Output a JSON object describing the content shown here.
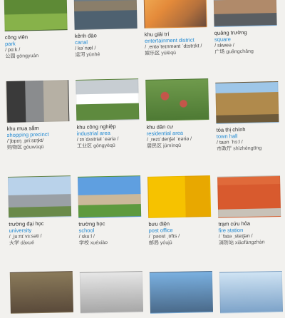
{
  "entries": [
    {
      "vn": "công viên",
      "en": "park",
      "ipa": "/ pɑːk /",
      "zh": "公园  gōngyuán"
    },
    {
      "vn": "kênh đào",
      "en": "canal",
      "ipa": "/ kəˈnæl /",
      "zh": "运河  yùnhé"
    },
    {
      "vn": "khu giải trí",
      "en": "entertainment district",
      "ipa": "/ ˌentəˈteɪnmənt ˈdɪstrɪkt /",
      "zh": "娱乐区  yúlèqū"
    },
    {
      "vn": "quảng trường",
      "en": "square",
      "ipa": "/ skweə /",
      "zh": "广场  guǎngchǎng"
    },
    {
      "vn": "khu mua sắm",
      "en": "shopping precinct",
      "ipa": "/ˈʃɒpɪŋ ˌpriːsɪŋkt/",
      "zh": "购物区  gòuwùqū"
    },
    {
      "vn": "khu công nghiệp",
      "en": "industrial area",
      "ipa": "/ ɪnˈdʌstriəl ˈeəriə /",
      "zh": "工业区  gōngyèqū"
    },
    {
      "vn": "khu dân cư",
      "en": "residential area",
      "ipa": "/ ˌrezɪˈdenʃəl ˈeəriə /",
      "zh": "居民区  jūmínqū"
    },
    {
      "vn": "tòa thị chính",
      "en": "town hall",
      "ipa": "/ taʊn ˈhɔːl /",
      "zh": "市政厅  shìzhèngtīng"
    },
    {
      "vn": "trường đại học",
      "en": "university",
      "ipa": "/ ˌjuːnɪˈvɜːsəti /",
      "zh": "大学  dàxué"
    },
    {
      "vn": "trường học",
      "en": "school",
      "ipa": "/ skuːl /",
      "zh": "学校  xuéxiào"
    },
    {
      "vn": "bưu điện",
      "en": "post office",
      "ipa": "/ ˈpəʊst ˌɒfɪs /",
      "zh": "邮局  yóujú"
    },
    {
      "vn": "trạm cứu hỏa",
      "en": "fire station",
      "ipa": "/ ˈfaɪə ˌsteɪʃən /",
      "zh": "消防站  xiāofángzhàn"
    }
  ]
}
